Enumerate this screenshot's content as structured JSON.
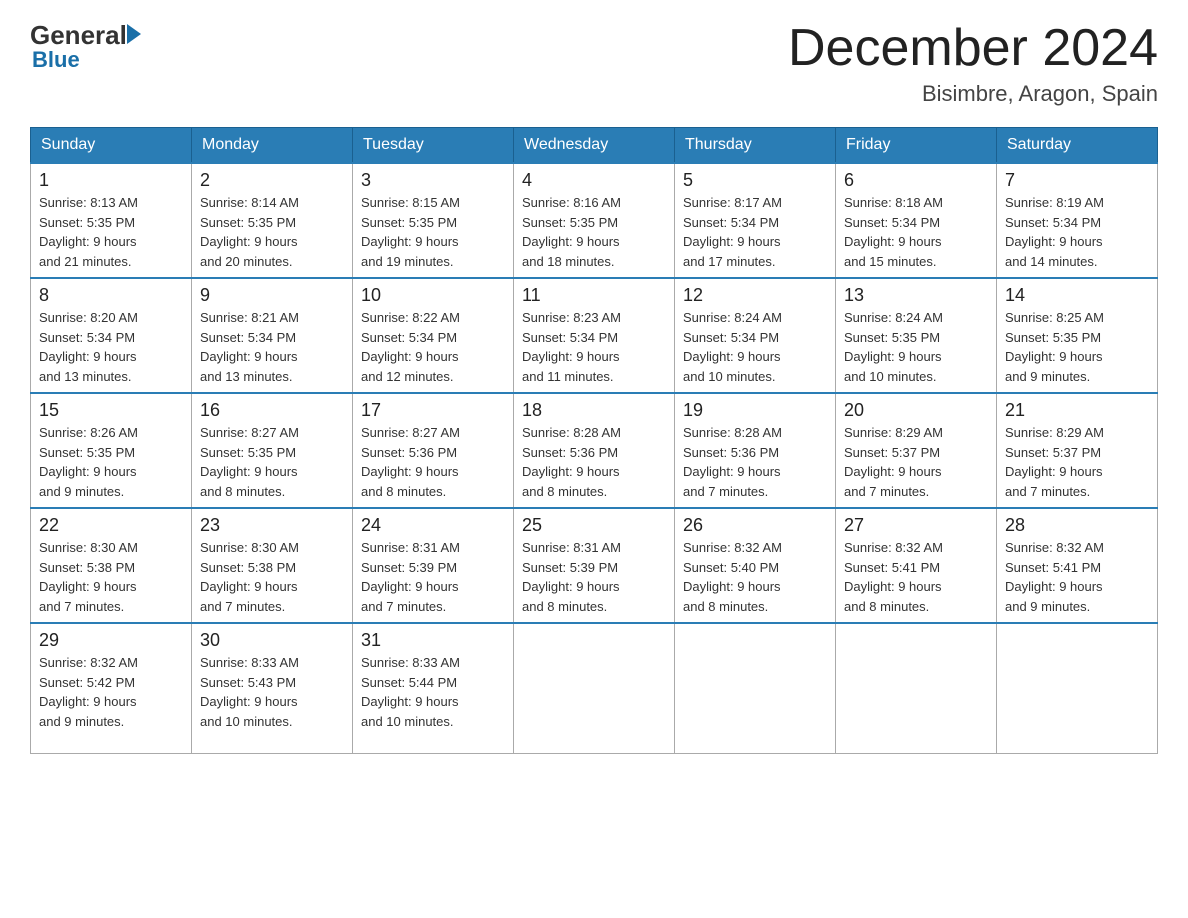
{
  "logo": {
    "general": "General",
    "blue": "Blue"
  },
  "title": {
    "month_year": "December 2024",
    "location": "Bisimbre, Aragon, Spain"
  },
  "headers": [
    "Sunday",
    "Monday",
    "Tuesday",
    "Wednesday",
    "Thursday",
    "Friday",
    "Saturday"
  ],
  "weeks": [
    [
      {
        "day": "1",
        "sunrise": "8:13 AM",
        "sunset": "5:35 PM",
        "daylight": "9 hours and 21 minutes."
      },
      {
        "day": "2",
        "sunrise": "8:14 AM",
        "sunset": "5:35 PM",
        "daylight": "9 hours and 20 minutes."
      },
      {
        "day": "3",
        "sunrise": "8:15 AM",
        "sunset": "5:35 PM",
        "daylight": "9 hours and 19 minutes."
      },
      {
        "day": "4",
        "sunrise": "8:16 AM",
        "sunset": "5:35 PM",
        "daylight": "9 hours and 18 minutes."
      },
      {
        "day": "5",
        "sunrise": "8:17 AM",
        "sunset": "5:34 PM",
        "daylight": "9 hours and 17 minutes."
      },
      {
        "day": "6",
        "sunrise": "8:18 AM",
        "sunset": "5:34 PM",
        "daylight": "9 hours and 15 minutes."
      },
      {
        "day": "7",
        "sunrise": "8:19 AM",
        "sunset": "5:34 PM",
        "daylight": "9 hours and 14 minutes."
      }
    ],
    [
      {
        "day": "8",
        "sunrise": "8:20 AM",
        "sunset": "5:34 PM",
        "daylight": "9 hours and 13 minutes."
      },
      {
        "day": "9",
        "sunrise": "8:21 AM",
        "sunset": "5:34 PM",
        "daylight": "9 hours and 13 minutes."
      },
      {
        "day": "10",
        "sunrise": "8:22 AM",
        "sunset": "5:34 PM",
        "daylight": "9 hours and 12 minutes."
      },
      {
        "day": "11",
        "sunrise": "8:23 AM",
        "sunset": "5:34 PM",
        "daylight": "9 hours and 11 minutes."
      },
      {
        "day": "12",
        "sunrise": "8:24 AM",
        "sunset": "5:34 PM",
        "daylight": "9 hours and 10 minutes."
      },
      {
        "day": "13",
        "sunrise": "8:24 AM",
        "sunset": "5:35 PM",
        "daylight": "9 hours and 10 minutes."
      },
      {
        "day": "14",
        "sunrise": "8:25 AM",
        "sunset": "5:35 PM",
        "daylight": "9 hours and 9 minutes."
      }
    ],
    [
      {
        "day": "15",
        "sunrise": "8:26 AM",
        "sunset": "5:35 PM",
        "daylight": "9 hours and 9 minutes."
      },
      {
        "day": "16",
        "sunrise": "8:27 AM",
        "sunset": "5:35 PM",
        "daylight": "9 hours and 8 minutes."
      },
      {
        "day": "17",
        "sunrise": "8:27 AM",
        "sunset": "5:36 PM",
        "daylight": "9 hours and 8 minutes."
      },
      {
        "day": "18",
        "sunrise": "8:28 AM",
        "sunset": "5:36 PM",
        "daylight": "9 hours and 8 minutes."
      },
      {
        "day": "19",
        "sunrise": "8:28 AM",
        "sunset": "5:36 PM",
        "daylight": "9 hours and 7 minutes."
      },
      {
        "day": "20",
        "sunrise": "8:29 AM",
        "sunset": "5:37 PM",
        "daylight": "9 hours and 7 minutes."
      },
      {
        "day": "21",
        "sunrise": "8:29 AM",
        "sunset": "5:37 PM",
        "daylight": "9 hours and 7 minutes."
      }
    ],
    [
      {
        "day": "22",
        "sunrise": "8:30 AM",
        "sunset": "5:38 PM",
        "daylight": "9 hours and 7 minutes."
      },
      {
        "day": "23",
        "sunrise": "8:30 AM",
        "sunset": "5:38 PM",
        "daylight": "9 hours and 7 minutes."
      },
      {
        "day": "24",
        "sunrise": "8:31 AM",
        "sunset": "5:39 PM",
        "daylight": "9 hours and 7 minutes."
      },
      {
        "day": "25",
        "sunrise": "8:31 AM",
        "sunset": "5:39 PM",
        "daylight": "9 hours and 8 minutes."
      },
      {
        "day": "26",
        "sunrise": "8:32 AM",
        "sunset": "5:40 PM",
        "daylight": "9 hours and 8 minutes."
      },
      {
        "day": "27",
        "sunrise": "8:32 AM",
        "sunset": "5:41 PM",
        "daylight": "9 hours and 8 minutes."
      },
      {
        "day": "28",
        "sunrise": "8:32 AM",
        "sunset": "5:41 PM",
        "daylight": "9 hours and 9 minutes."
      }
    ],
    [
      {
        "day": "29",
        "sunrise": "8:32 AM",
        "sunset": "5:42 PM",
        "daylight": "9 hours and 9 minutes."
      },
      {
        "day": "30",
        "sunrise": "8:33 AM",
        "sunset": "5:43 PM",
        "daylight": "9 hours and 10 minutes."
      },
      {
        "day": "31",
        "sunrise": "8:33 AM",
        "sunset": "5:44 PM",
        "daylight": "9 hours and 10 minutes."
      },
      null,
      null,
      null,
      null
    ]
  ],
  "labels": {
    "sunrise": "Sunrise:",
    "sunset": "Sunset:",
    "daylight": "Daylight: 9 hours"
  }
}
